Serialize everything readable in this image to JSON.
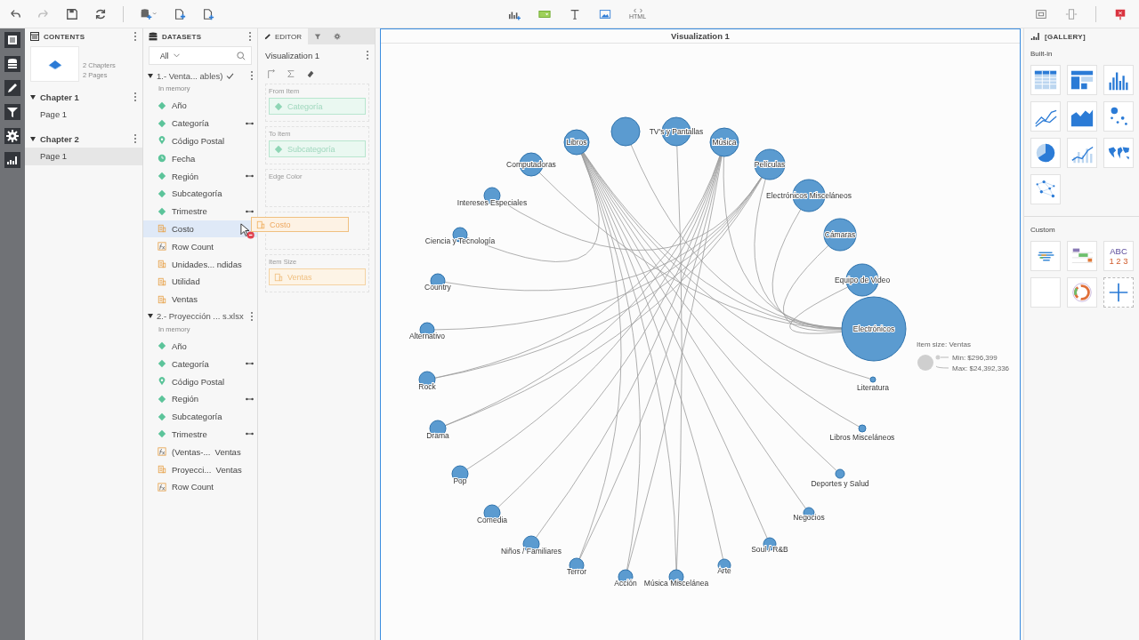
{
  "toolbar": {
    "html_label": "HTML"
  },
  "contents": {
    "title": "CONTENTS",
    "summary": [
      "2 Chapters",
      "2 Pages"
    ],
    "chapters": [
      {
        "label": "Chapter 1",
        "expanded": true,
        "pages": [
          {
            "label": "Page 1",
            "selected": false
          }
        ]
      },
      {
        "label": "Chapter 2",
        "expanded": true,
        "pages": [
          {
            "label": "Page 1",
            "selected": true
          }
        ]
      }
    ]
  },
  "datasets": {
    "title": "DATASETS",
    "filter": "All",
    "groups": [
      {
        "label": "1.- Venta... ables)",
        "checked": true,
        "expanded": true,
        "status": "In memory",
        "items": [
          {
            "label": "Año",
            "kind": "dim",
            "linked": false,
            "selected": false
          },
          {
            "label": "Categoría",
            "kind": "dim",
            "linked": true,
            "selected": false
          },
          {
            "label": "Código Postal",
            "kind": "geo",
            "linked": false,
            "selected": false
          },
          {
            "label": "Fecha",
            "kind": "date",
            "linked": false,
            "selected": false
          },
          {
            "label": "Región",
            "kind": "dim",
            "linked": true,
            "selected": false
          },
          {
            "label": "Subcategoría",
            "kind": "dim",
            "linked": false,
            "selected": false
          },
          {
            "label": "Trimestre",
            "kind": "dim",
            "linked": true,
            "selected": false
          },
          {
            "label": "Costo",
            "kind": "measure",
            "linked": false,
            "selected": true
          },
          {
            "label": "Row Count",
            "kind": "calc",
            "linked": false,
            "selected": false
          },
          {
            "label": "Unidades... ndidas",
            "kind": "measure",
            "linked": false,
            "selected": false
          },
          {
            "label": "Utilidad",
            "kind": "measure",
            "linked": false,
            "selected": false
          },
          {
            "label": "Ventas",
            "kind": "measure",
            "linked": false,
            "selected": false
          }
        ]
      },
      {
        "label": "2.- Proyección ... s.xlsx",
        "checked": false,
        "expanded": true,
        "status": "In memory",
        "items": [
          {
            "label": "Año",
            "kind": "dim",
            "linked": false,
            "selected": false
          },
          {
            "label": "Categoría",
            "kind": "dim",
            "linked": true,
            "selected": false
          },
          {
            "label": "Código Postal",
            "kind": "geo",
            "linked": false,
            "selected": false
          },
          {
            "label": "Región",
            "kind": "dim",
            "linked": true,
            "selected": false
          },
          {
            "label": "Subcategoría",
            "kind": "dim",
            "linked": false,
            "selected": false
          },
          {
            "label": "Trimestre",
            "kind": "dim",
            "linked": true,
            "selected": false
          },
          {
            "label": "(Ventas-...  Ventas",
            "kind": "calc",
            "linked": false,
            "selected": false
          },
          {
            "label": "Proyecci...  Ventas",
            "kind": "measure",
            "linked": false,
            "selected": false
          },
          {
            "label": "Row Count",
            "kind": "calc",
            "linked": false,
            "selected": false
          }
        ]
      }
    ]
  },
  "editor": {
    "tabs": [
      {
        "label": "EDITOR",
        "kind": "editor",
        "selected": true
      },
      {
        "kind": "filter",
        "selected": false
      },
      {
        "kind": "settings",
        "selected": false
      }
    ],
    "title": "Visualization 1",
    "slots": [
      {
        "label": "From Item",
        "field": {
          "label": "Categoría",
          "kind": "dim"
        }
      },
      {
        "label": "To Item",
        "field": {
          "label": "Subcategoría",
          "kind": "dim"
        }
      },
      {
        "label": "Edge Color"
      },
      {
        "kind": "drop_target",
        "ghost": {
          "label": "Costo"
        }
      },
      {
        "label": "Item Size",
        "field": {
          "label": "Ventas",
          "kind": "measure"
        }
      }
    ]
  },
  "canvas": {
    "title": "Visualization 1",
    "nodes": [
      "Libros",
      "TV's y Pantallas",
      "Música",
      "Películas",
      "Electrónicos Misceláneos",
      "Cámaras",
      "Equipo de Video",
      "Electrónicos",
      "Literatura",
      "Libros Misceláneos",
      "Deportes y Salud",
      "Negocios",
      "Soul / R&B",
      "Arte",
      "Acción",
      "Música Miscelánea",
      "Computadoras",
      "Intereses Especiales",
      "Ciencia y Tecnología",
      "Country",
      "Alternativo",
      "Rock",
      "Drama",
      "Pop",
      "Comedia",
      "Niños / Familiares",
      "Terror"
    ],
    "legend": {
      "title": "Item size: Ventas",
      "min": "Min: $296,399",
      "max": "Max: $24,392,336"
    }
  },
  "gallery": {
    "title": "[GALLERY]",
    "builtin_label": "Built-in",
    "builtin": [
      {
        "kind": "table"
      },
      {
        "kind": "pivot"
      },
      {
        "kind": "bar"
      },
      {
        "kind": "line"
      },
      {
        "kind": "area"
      },
      {
        "kind": "scatter"
      },
      {
        "kind": "pie"
      },
      {
        "kind": "combo"
      },
      {
        "kind": "map"
      },
      {
        "kind": "network"
      }
    ],
    "custom_label": "Custom",
    "custom": [
      {
        "kind": "wordcloud"
      },
      {
        "kind": "gantt"
      },
      {
        "kind": "text",
        "lines": [
          "ABC",
          "1 2 3"
        ]
      },
      {
        "kind": "blank"
      },
      {
        "kind": "donut"
      },
      {
        "kind": "add"
      }
    ]
  }
}
